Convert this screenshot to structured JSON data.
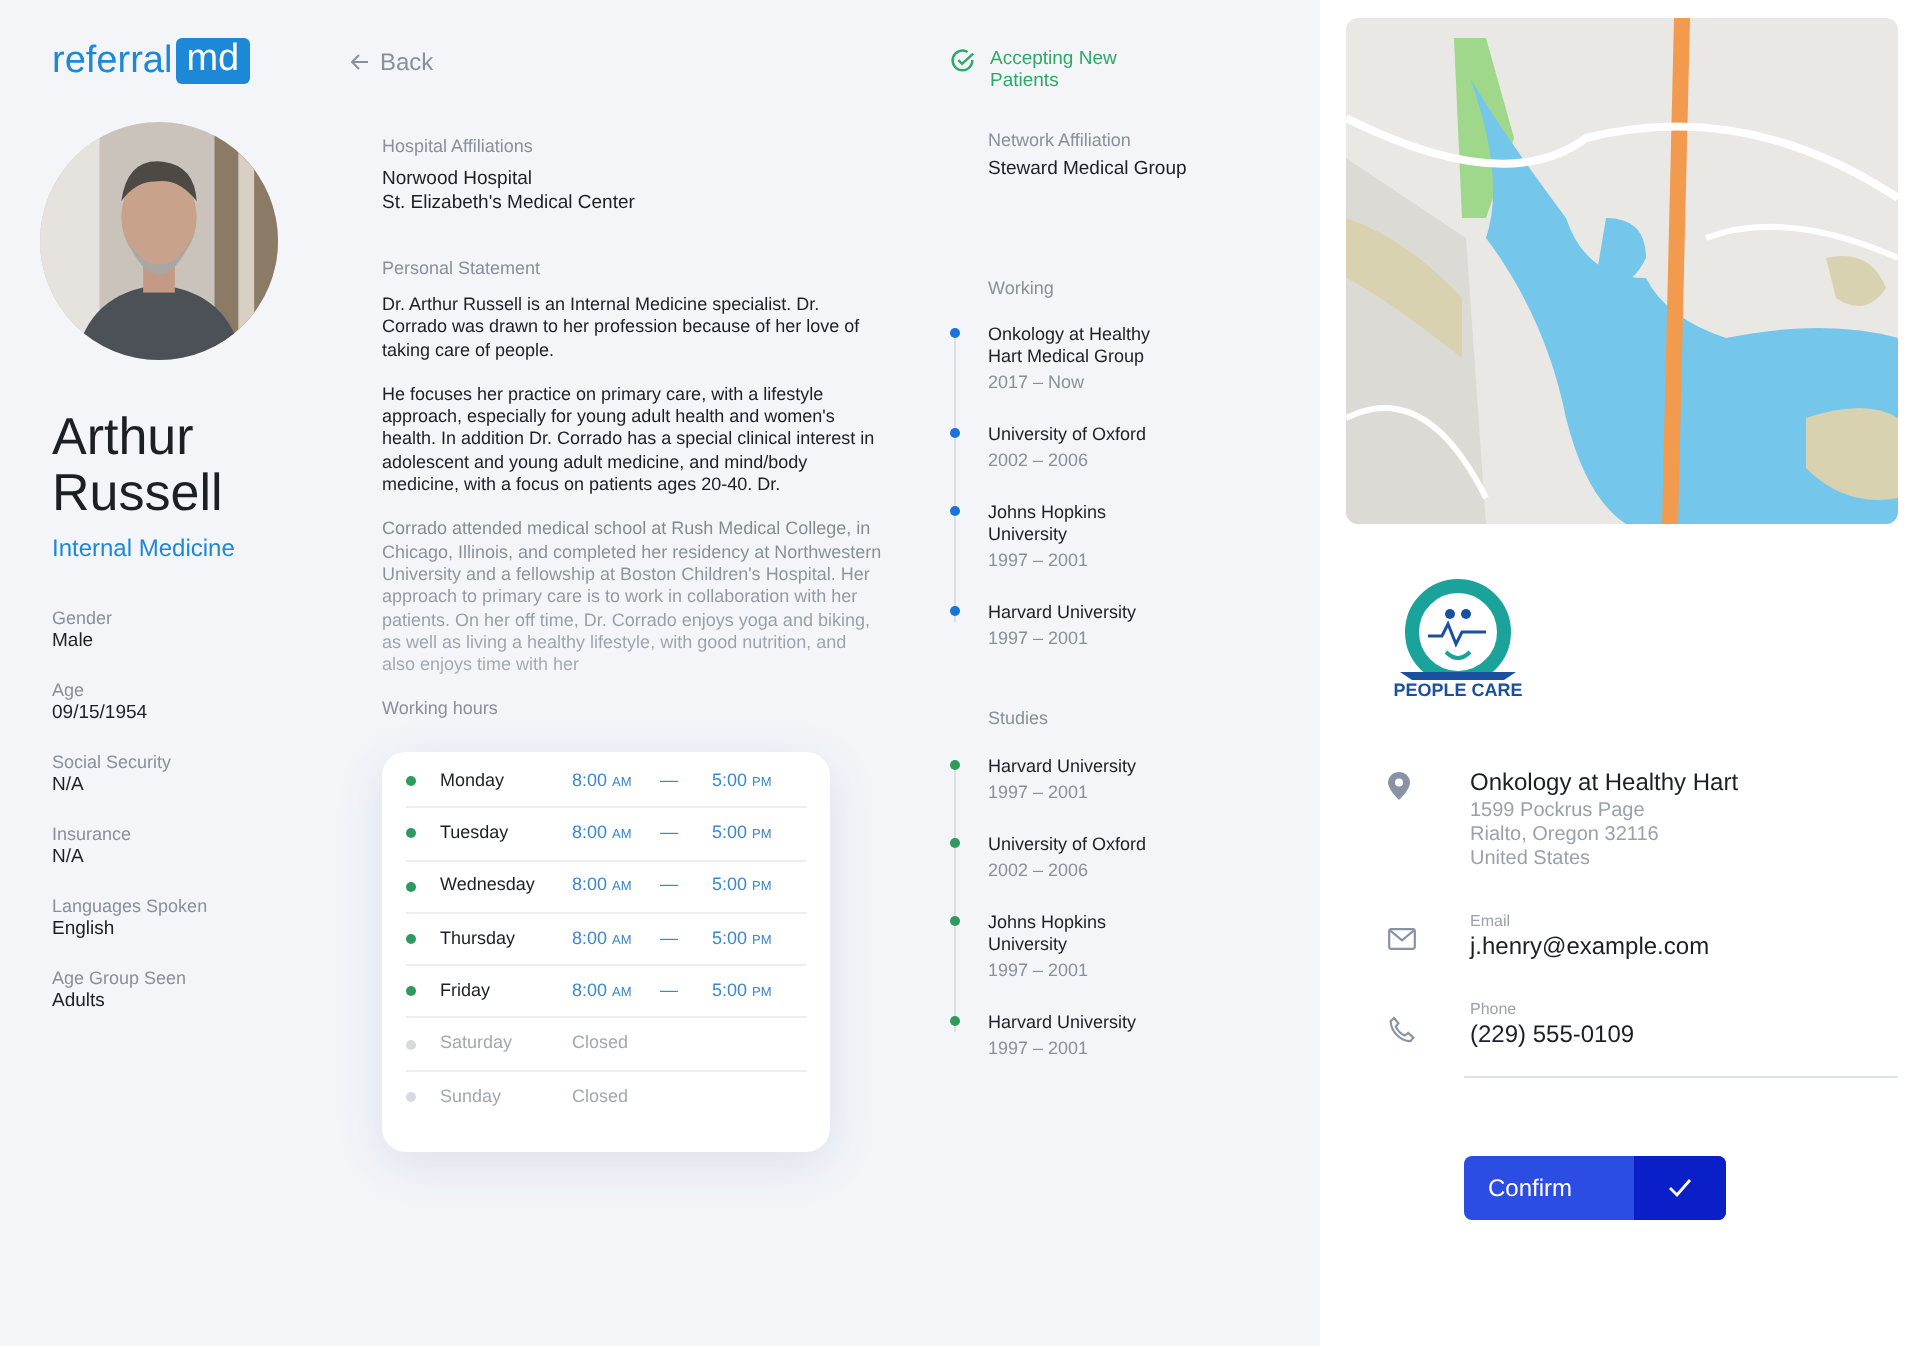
{
  "logo": {
    "text": "referral",
    "badge": "md"
  },
  "back": {
    "label": "Back"
  },
  "profile": {
    "name": "Arthur Russell",
    "specialty": "Internal Medicine",
    "fields": [
      {
        "label": "Gender",
        "value": "Male"
      },
      {
        "label": "Age",
        "value": "09/15/1954"
      },
      {
        "label": "Social Security",
        "value": "N/A"
      },
      {
        "label": "Insurance",
        "value": "N/A"
      },
      {
        "label": "Languages Spoken",
        "value": "English"
      },
      {
        "label": "Age Group Seen",
        "value": "Adults"
      }
    ]
  },
  "hospital_affiliations": {
    "label": "Hospital Affiliations",
    "lines": [
      "Norwood Hospital",
      "St. Elizabeth's Medical Center"
    ]
  },
  "personal_statement": {
    "label": "Personal Statement",
    "paragraphs": [
      {
        "text": "Dr. Arthur Russell is an Internal Medicine specialist. Dr. Corrado was drawn to her profession because of her love of taking care of people.",
        "faded": false
      },
      {
        "text": "He focuses her practice on primary care, with a lifestyle approach, especially for young adult health and women's health. In addition Dr. Corrado has a special clinical interest in adolescent and young adult medicine, and mind/body medicine, with a focus on patients ages 20-40. Dr.",
        "faded": false
      },
      {
        "text": "Corrado attended medical school at Rush Medical College, in Chicago, Illinois, and completed her residency at Northwestern University and a fellowship at Boston Children's Hospital. Her approach to primary care is to work in collaboration with her patients. On her off time, Dr. Corrado enjoys yoga and biking, as well as living a healthy lifestyle, with good nutrition, and also enjoys time with her",
        "faded": true
      }
    ]
  },
  "working_hours": {
    "label": "Working hours",
    "days": [
      {
        "day": "Monday",
        "open": true,
        "from": "8:00",
        "from_period": "AM",
        "dash": "—",
        "to": "5:00",
        "to_period": "PM"
      },
      {
        "day": "Tuesday",
        "open": true,
        "from": "8:00",
        "from_period": "AM",
        "dash": "—",
        "to": "5:00",
        "to_period": "PM"
      },
      {
        "day": "Wednesday",
        "open": true,
        "from": "8:00",
        "from_period": "AM",
        "dash": "—",
        "to": "5:00",
        "to_period": "PM"
      },
      {
        "day": "Thursday",
        "open": true,
        "from": "8:00",
        "from_period": "AM",
        "dash": "—",
        "to": "5:00",
        "to_period": "PM"
      },
      {
        "day": "Friday",
        "open": true,
        "from": "8:00",
        "from_period": "AM",
        "dash": "—",
        "to": "5:00",
        "to_period": "PM"
      },
      {
        "day": "Saturday",
        "open": false,
        "closed_text": "Closed"
      },
      {
        "day": "Sunday",
        "open": false,
        "closed_text": "Closed"
      }
    ]
  },
  "accepting": {
    "label": "Accepting New Patients",
    "on": true
  },
  "network_affiliation": {
    "label": "Network Affiliation",
    "value": "Steward Medical Group"
  },
  "timelines": [
    {
      "label": "Working",
      "color": "#1a73d9",
      "items": [
        {
          "title": "Onkology at Healthy Hart Medical Group",
          "years": "2017 – Now"
        },
        {
          "title": "University of Oxford",
          "years": "2002 – 2006"
        },
        {
          "title": "Johns Hopkins University",
          "years": "1997 – 2001"
        },
        {
          "title": "Harvard University",
          "years": "1997 – 2001"
        }
      ]
    },
    {
      "label": "Studies",
      "color": "#2e9a5e",
      "items": [
        {
          "title": "Harvard University",
          "years": "1997 – 2001"
        },
        {
          "title": "University of Oxford",
          "years": "2002 – 2006"
        },
        {
          "title": "Johns Hopkins University",
          "years": "1997 – 2001"
        },
        {
          "title": "Harvard University",
          "years": "1997 – 2001"
        }
      ]
    }
  ],
  "hospital_logo": {
    "name": "PEOPLE CARE"
  },
  "contact": [
    {
      "kind": "address",
      "title": "Onkology at Healthy Hart",
      "lines": [
        "1599 Pockrus Page",
        "Rialto, Oregon 32116",
        "United States"
      ]
    },
    {
      "kind": "email",
      "label": "Email",
      "value": "j.henry@example.com"
    },
    {
      "kind": "phone",
      "label": "Phone",
      "value": "(229) 555-0109"
    }
  ],
  "confirm": {
    "label": "Confirm"
  }
}
